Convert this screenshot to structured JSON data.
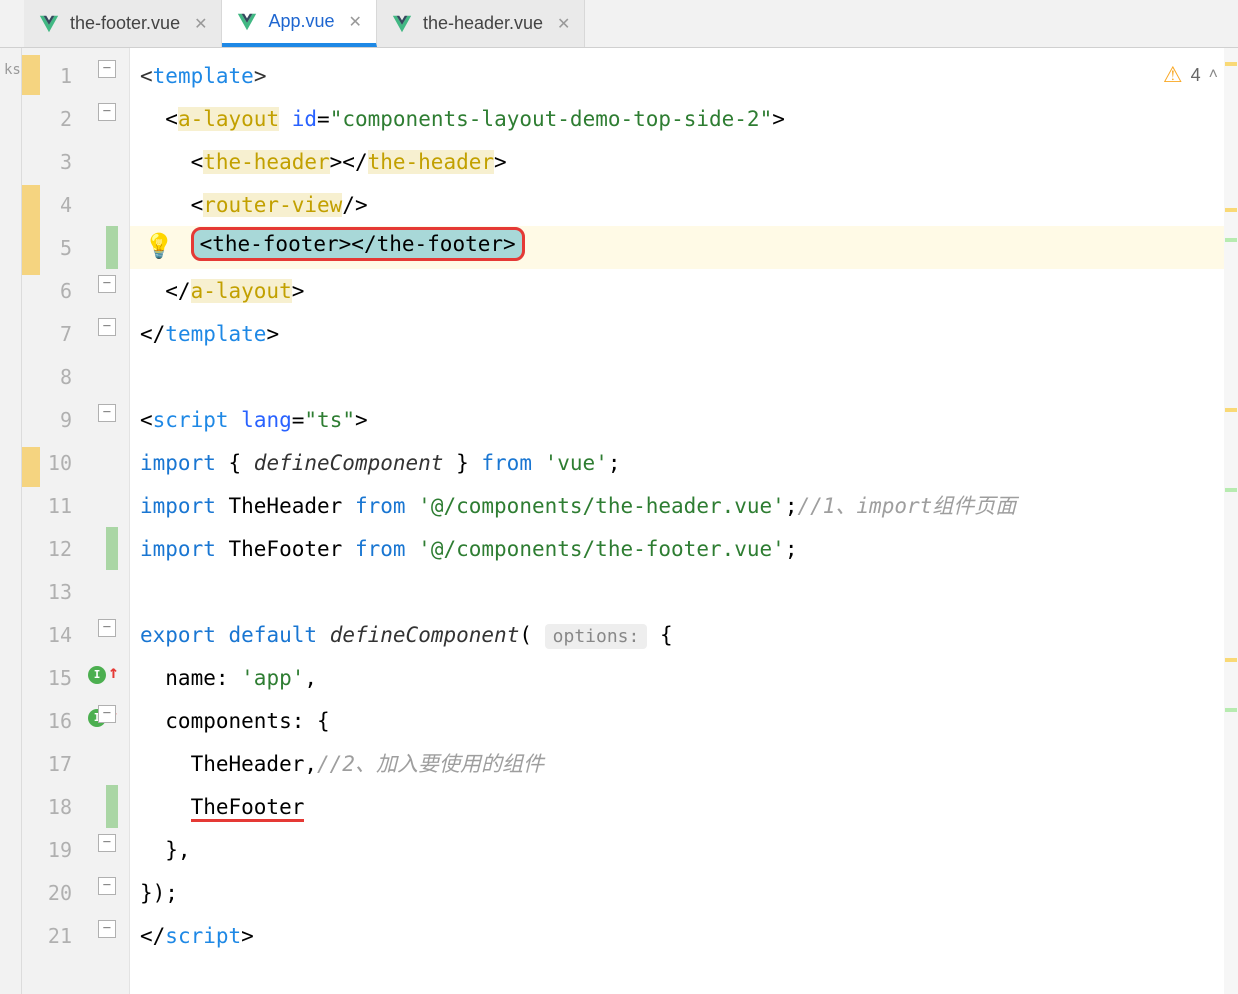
{
  "tabs": [
    {
      "label": "the-footer.vue",
      "active": false
    },
    {
      "label": "App.vue",
      "active": true
    },
    {
      "label": "the-header.vue",
      "active": false
    }
  ],
  "warnings_count": "4",
  "left_label": "ks",
  "lines": {
    "1": "1",
    "2": "2",
    "3": "3",
    "4": "4",
    "5": "5",
    "6": "6",
    "7": "7",
    "8": "8",
    "9": "9",
    "10": "10",
    "11": "11",
    "12": "12",
    "13": "13",
    "14": "14",
    "15": "15",
    "16": "16",
    "17": "17",
    "18": "18",
    "19": "19",
    "20": "20",
    "21": "21"
  },
  "code": {
    "l1": {
      "a": "<",
      "b": "template",
      "c": ">"
    },
    "l2": {
      "a": "  <",
      "b": "a-layout",
      "c": " ",
      "d": "id",
      "e": "=",
      "f": "\"components-layout-demo-top-side-2\"",
      "g": ">"
    },
    "l3": {
      "a": "    <",
      "b": "the-header",
      "c": "></",
      "d": "the-header",
      "e": ">"
    },
    "l4": {
      "a": "    <",
      "b": "router-view",
      "c": "/>"
    },
    "l5": {
      "a": "    ",
      "sel": "<the-footer></the-footer>"
    },
    "l6": {
      "a": "  </",
      "b": "a-layout",
      "c": ">"
    },
    "l7": {
      "a": "</",
      "b": "template",
      "c": ">"
    },
    "l9": {
      "a": "<",
      "b": "script",
      "c": " ",
      "d": "lang",
      "e": "=",
      "f": "\"ts\"",
      "g": ">"
    },
    "l10": {
      "a": "import",
      "b": " { ",
      "c": "defineComponent",
      "d": " } ",
      "e": "from",
      "f": " ",
      "g": "'vue'",
      "h": ";"
    },
    "l11": {
      "a": "import",
      "b": " TheHeader ",
      "c": "from",
      "d": " ",
      "e": "'@/components/the-header.vue'",
      "f": ";",
      "g": "//1、import组件页面"
    },
    "l12": {
      "a": "import",
      "b": " TheFooter ",
      "c": "from",
      "d": " ",
      "e": "'@/components/the-footer.vue'",
      "f": ";"
    },
    "l14": {
      "a": "export",
      "b": " ",
      "c": "default",
      "d": " ",
      "e": "defineComponent",
      "f": "( ",
      "g": "options:",
      "h": " {"
    },
    "l15": {
      "a": "  name: ",
      "b": "'app'",
      "c": ","
    },
    "l16": {
      "a": "  components: {"
    },
    "l17": {
      "a": "    TheHeader,",
      "b": "//2、加入要使用的组件"
    },
    "l18": {
      "a": "    ",
      "b": "TheFooter"
    },
    "l19": {
      "a": "  },"
    },
    "l20": {
      "a": "});"
    },
    "l21": {
      "a": "</",
      "b": "script",
      "c": ">"
    }
  },
  "gutter_badge": "I"
}
